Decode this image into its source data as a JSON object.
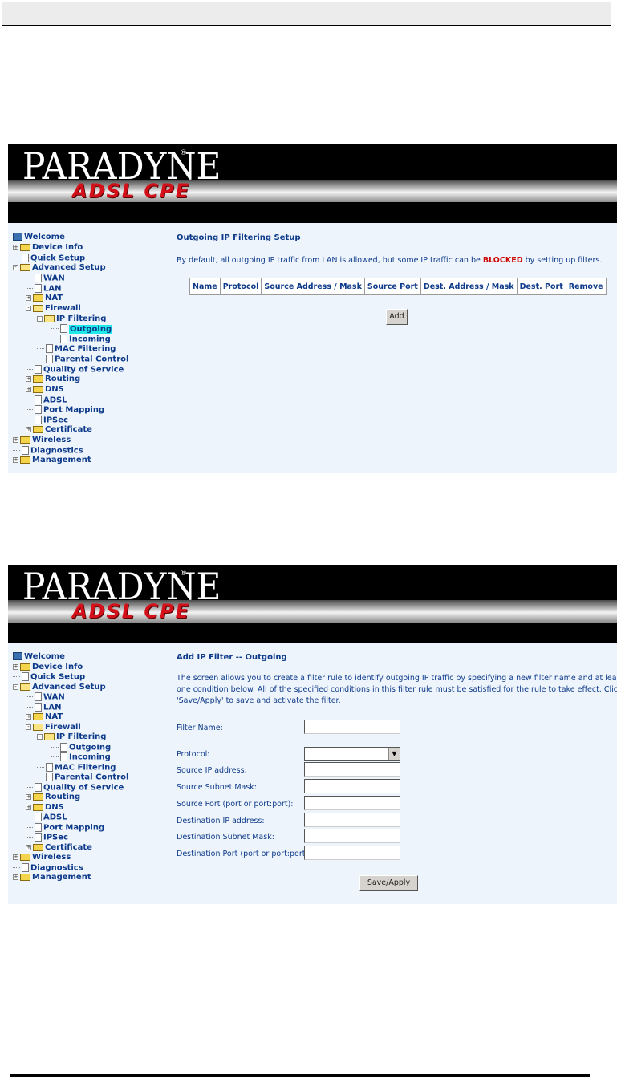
{
  "brand": {
    "title": "PARADYNE",
    "registered": "®",
    "subtitle": "ADSL CPE"
  },
  "tree": {
    "welcome": "Welcome",
    "device_info": "Device Info",
    "quick_setup": "Quick Setup",
    "advanced_setup": "Advanced Setup",
    "wan": "WAN",
    "lan": "LAN",
    "nat": "NAT",
    "firewall": "Firewall",
    "ip_filtering": "IP Filtering",
    "outgoing": "Outgoing",
    "incoming": "Incoming",
    "mac_filtering": "MAC Filtering",
    "parental_control": "Parental Control",
    "qos": "Quality of Service",
    "routing": "Routing",
    "dns": "DNS",
    "adsl": "ADSL",
    "port_mapping": "Port Mapping",
    "ipsec": "IPSec",
    "certificate": "Certificate",
    "wireless": "Wireless",
    "diagnostics": "Diagnostics",
    "management": "Management"
  },
  "outgoing_page": {
    "title": "Outgoing IP Filtering Setup",
    "desc_before": "By default, all outgoing IP traffic from LAN is allowed, but some IP traffic can be ",
    "desc_blocked": "BLOCKED",
    "desc_after": " by setting up filters.",
    "columns": [
      "Name",
      "Protocol",
      "Source Address / Mask",
      "Source Port",
      "Dest. Address / Mask",
      "Dest. Port",
      "Remove"
    ],
    "add_button": "Add"
  },
  "add_page": {
    "title": "Add IP Filter -- Outgoing",
    "desc_line1": "The screen allows you to create a filter rule to identify outgoing IP traffic by specifying a new filter name and at least",
    "desc_line2": "one condition below. All of the specified conditions in this filter rule must be satisfied for the rule to take effect. Click",
    "desc_line3": "'Save/Apply' to save and activate the filter.",
    "labels": {
      "filter_name": "Filter Name:",
      "protocol": "Protocol:",
      "source_ip": "Source IP address:",
      "source_mask": "Source Subnet Mask:",
      "source_port": "Source Port (port or port:port):",
      "dest_ip": "Destination IP address:",
      "dest_mask": "Destination Subnet Mask:",
      "dest_port": "Destination Port (port or port:port):"
    },
    "values": {
      "filter_name": "",
      "protocol": "",
      "source_ip": "",
      "source_mask": "",
      "source_port": "",
      "dest_ip": "",
      "dest_mask": "",
      "dest_port": ""
    },
    "save_button": "Save/Apply"
  }
}
